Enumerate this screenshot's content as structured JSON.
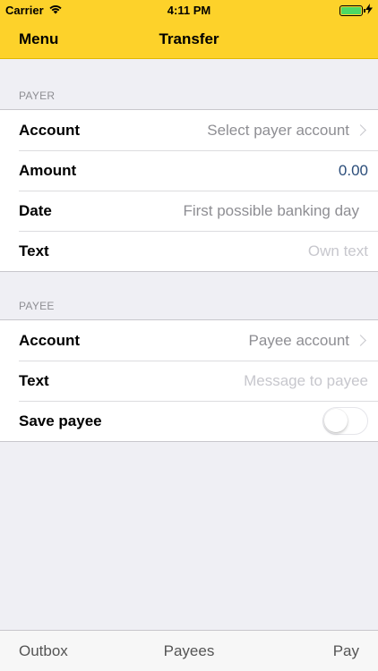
{
  "status_bar": {
    "carrier": "Carrier",
    "time": "4:11 PM",
    "battery_color": "#4cd964"
  },
  "nav": {
    "menu_label": "Menu",
    "title": "Transfer"
  },
  "payer": {
    "header": "PAYER",
    "account_label": "Account",
    "account_value": "Select payer account",
    "amount_label": "Amount",
    "amount_value": "0.00",
    "date_label": "Date",
    "date_value": "First possible banking day",
    "text_label": "Text",
    "text_placeholder": "Own text"
  },
  "payee": {
    "header": "PAYEE",
    "account_label": "Account",
    "account_value": "Payee account",
    "text_label": "Text",
    "text_placeholder": "Message to payee",
    "save_label": "Save payee",
    "save_enabled": false
  },
  "tabs": {
    "outbox": "Outbox",
    "payees": "Payees",
    "pay": "Pay"
  },
  "colors": {
    "accent": "#fdd22a",
    "amount": "#2b4d7a"
  },
  "icons": {
    "wifi": "wifi-icon",
    "charging": "bolt-icon",
    "disclosure": "chevron-right-icon"
  }
}
